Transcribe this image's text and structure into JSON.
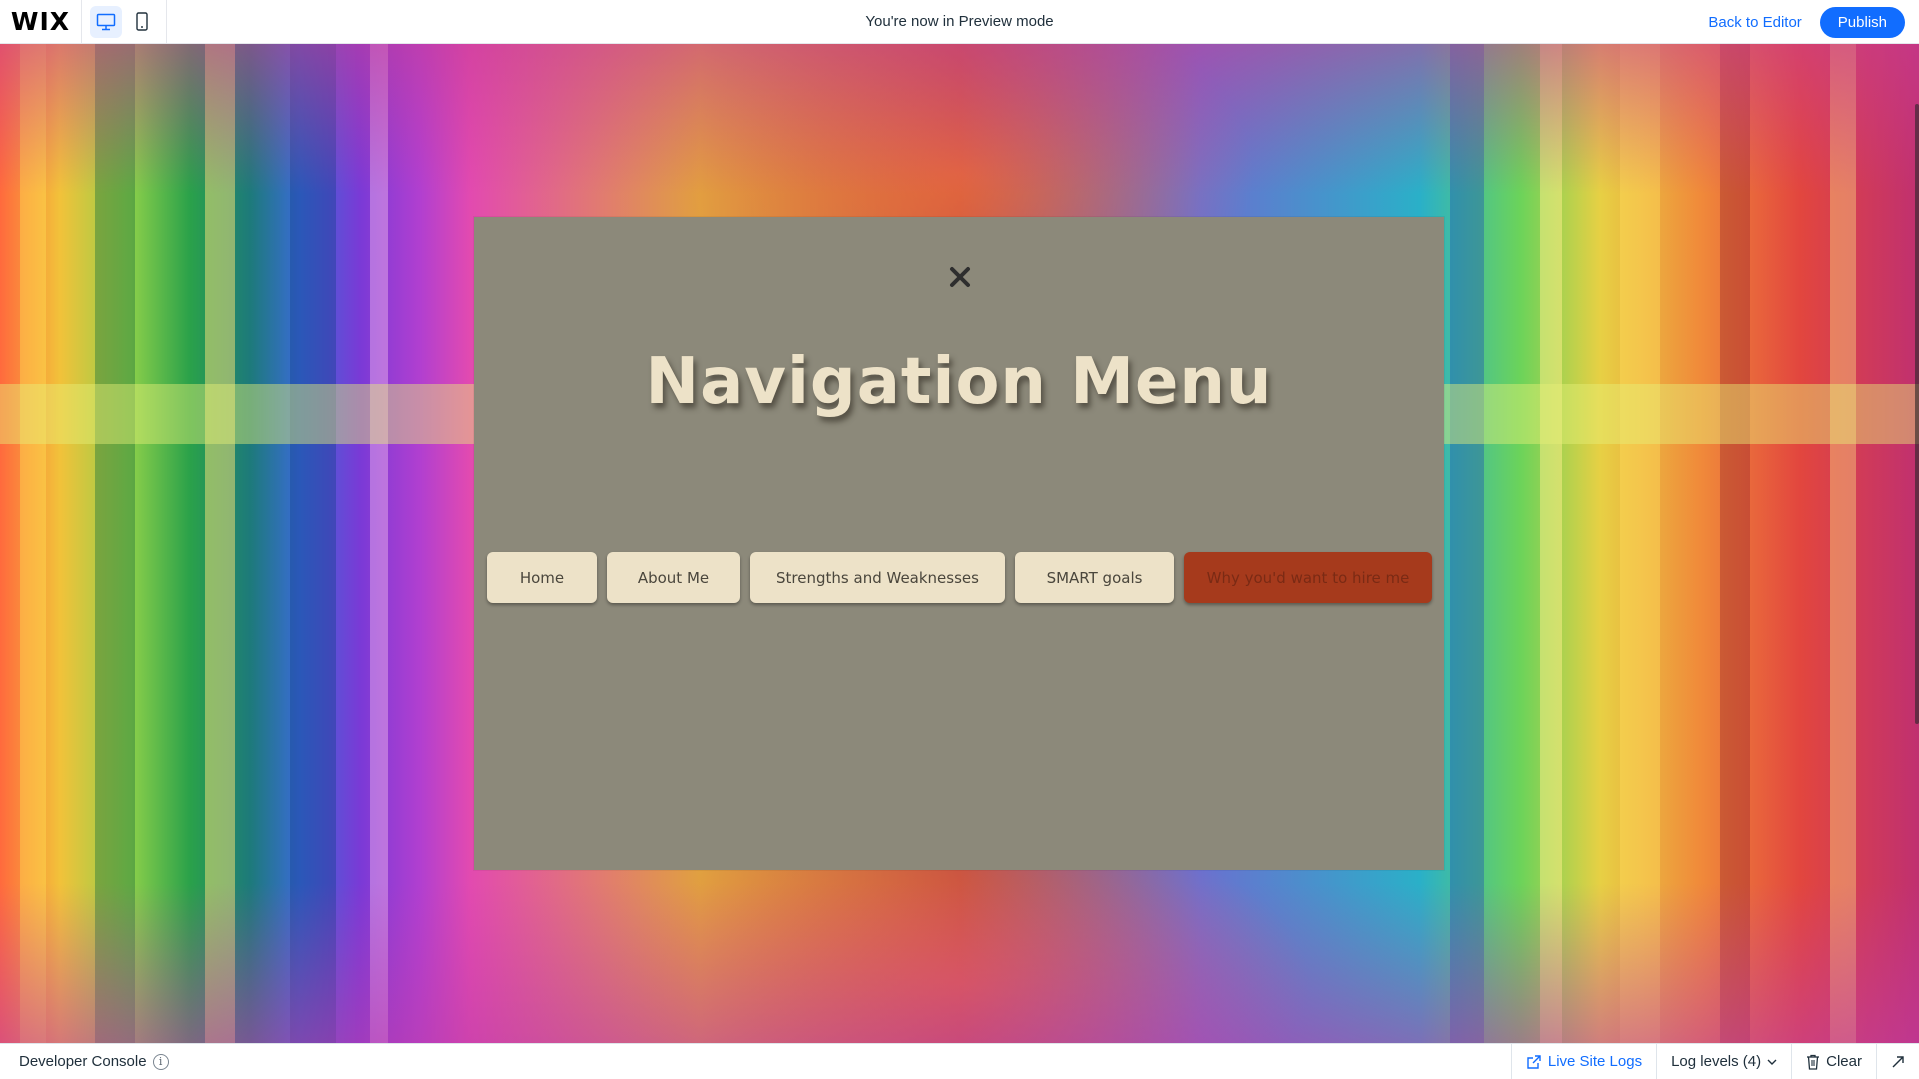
{
  "topbar": {
    "logo": "WIX",
    "preview_label": "You're now in Preview mode",
    "back_label": "Back to Editor",
    "publish_label": "Publish"
  },
  "lightbox": {
    "title": "Navigation Menu",
    "menu": [
      {
        "label": "Home"
      },
      {
        "label": "About Me"
      },
      {
        "label": "Strengths and Weaknesses"
      },
      {
        "label": "SMART goals"
      },
      {
        "label": "Why you'd want to hire me",
        "active": true
      }
    ]
  },
  "devconsole": {
    "title": "Developer Console",
    "info_glyph": "i",
    "live_logs": "Live Site Logs",
    "log_levels": "Log levels (4)",
    "clear": "Clear"
  },
  "colors": {
    "accent": "#116dff",
    "lightbox_bg": "#8c897a",
    "menu_bg": "#ede2c8",
    "menu_active": "#a63a1c"
  },
  "icons": [
    "desktop-icon",
    "mobile-icon",
    "close-icon",
    "info-icon",
    "external-link-icon",
    "chevron-down-icon",
    "trash-icon",
    "expand-icon"
  ]
}
